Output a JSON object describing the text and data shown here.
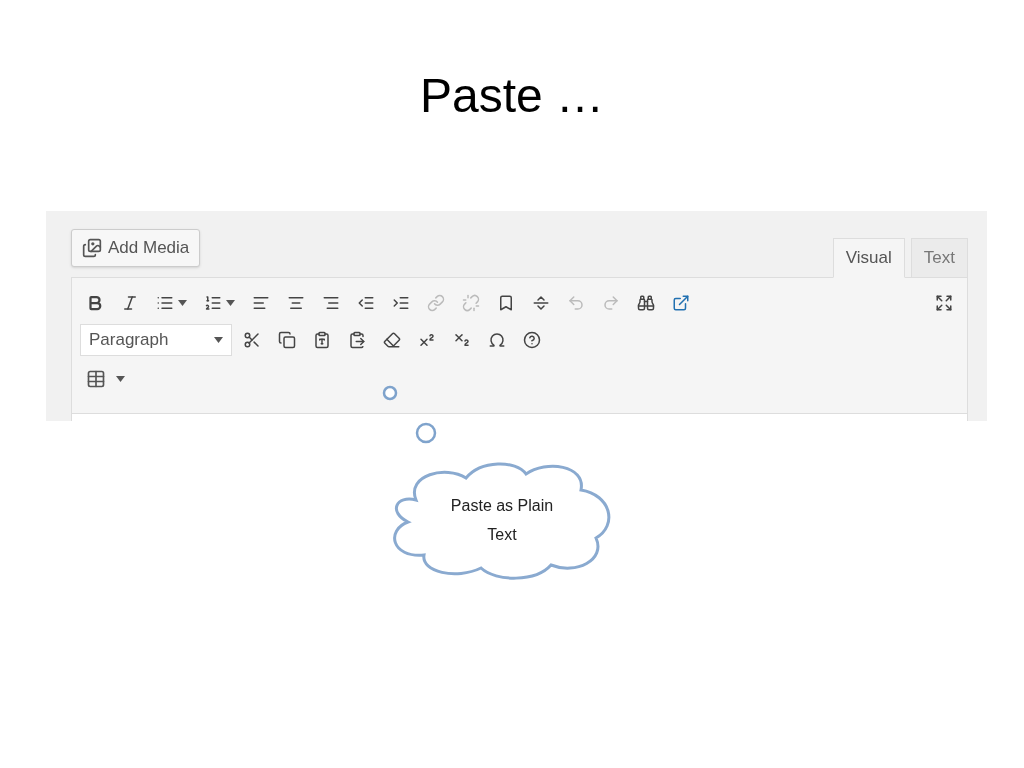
{
  "slide": {
    "title": "Paste …"
  },
  "editor": {
    "add_media": "Add Media",
    "tabs": [
      {
        "label": "Visual",
        "selected": true
      },
      {
        "label": "Text",
        "selected": false
      }
    ],
    "toolbar_row_1": [
      {
        "disabled": false
      },
      {
        "disabled": false
      },
      {
        "disabled": false
      },
      {
        "disabled": false
      },
      {
        "disabled": false
      },
      {
        "disabled": false
      },
      {
        "disabled": false
      },
      {
        "disabled": false
      },
      {
        "disabled": false
      },
      {
        "disabled": true
      },
      {
        "disabled": true
      },
      {
        "disabled": false
      },
      {
        "disabled": false
      },
      {
        "disabled": true
      },
      {
        "disabled": true
      },
      {
        "disabled": false
      },
      {
        "disabled": false
      },
      {
        "disabled": false
      }
    ],
    "format_select": {
      "value": "Paragraph"
    },
    "toolbar_row_2": [
      {
        "disabled": false
      },
      {
        "disabled": false
      },
      {
        "disabled": false
      },
      {
        "disabled": false
      },
      {
        "disabled": false
      },
      {
        "disabled": false
      },
      {
        "disabled": false
      },
      {
        "disabled": false
      },
      {
        "disabled": false
      }
    ]
  },
  "callout": {
    "text": "Paste as Plain Text"
  }
}
